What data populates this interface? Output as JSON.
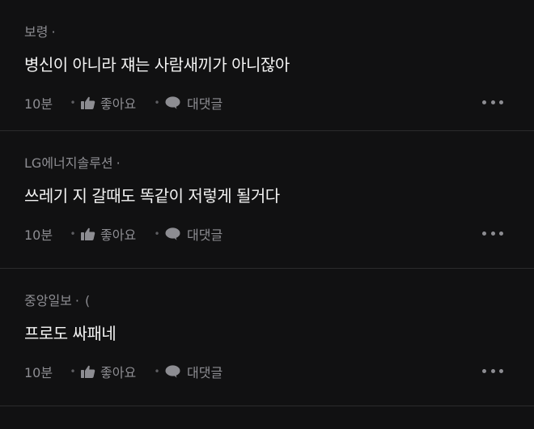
{
  "comments": [
    {
      "author": "보령",
      "meta_sep": "·",
      "meta_tail": "",
      "text": "병신이 아니라 쟤는 사람새끼가 아니잖아",
      "time": "10분",
      "like_label": "좋아요",
      "reply_label": "대댓글"
    },
    {
      "author": "LG에너지솔루션",
      "meta_sep": "·",
      "meta_tail": "",
      "text": "쓰레기 지 갈때도 똑같이 저렇게 될거다",
      "time": "10분",
      "like_label": "좋아요",
      "reply_label": "대댓글"
    },
    {
      "author": "중앙일보",
      "meta_sep": "·",
      "meta_tail": "(",
      "text": "프로도 싸패네",
      "time": "10분",
      "like_label": "좋아요",
      "reply_label": "대댓글"
    }
  ],
  "icons": {
    "like": "thumbs-up-icon",
    "reply": "speech-bubble-icon",
    "more": "more-horizontal-icon"
  },
  "colors": {
    "background": "#111112",
    "text": "#f3f3f3",
    "muted": "#8d8d92",
    "divider": "#2b2b2d"
  }
}
